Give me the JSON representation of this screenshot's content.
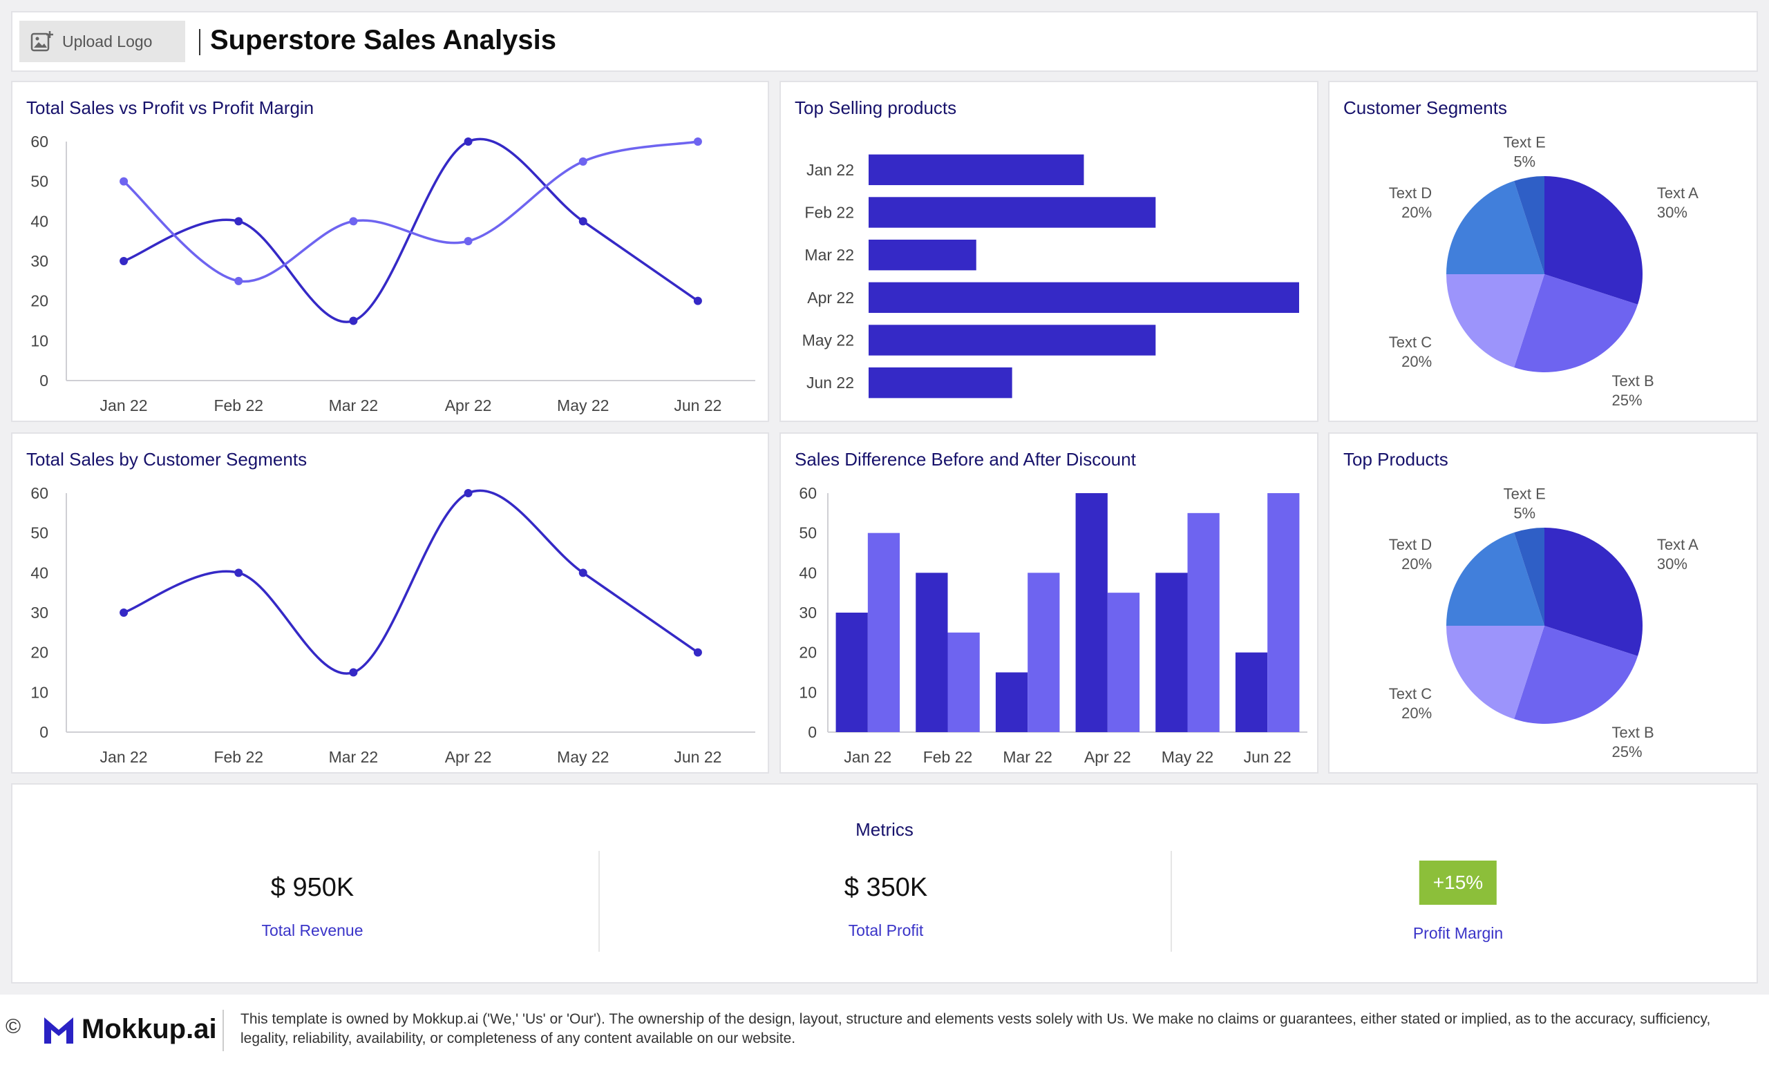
{
  "header": {
    "upload_label": "Upload Logo",
    "title": "Superstore Sales Analysis"
  },
  "colors": {
    "dark": "#3529c6",
    "medium": "#6e64f0",
    "light": "#9c94fb",
    "blue": "#417fdb",
    "darkblue": "#2f5fc6",
    "accent_green": "#8cbf3a",
    "title": "#17126b"
  },
  "cards": {
    "sales_profit": {
      "title": "Total Sales vs Profit vs Profit Margin"
    },
    "top_selling": {
      "title": "Top Selling products"
    },
    "customer_segments": {
      "title": "Customer Segments"
    },
    "sales_segments": {
      "title": "Total Sales by Customer Segments"
    },
    "discount": {
      "title": "Sales Difference Before and After Discount"
    },
    "top_products": {
      "title": "Top Products"
    }
  },
  "chart_data": [
    {
      "id": "sales_profit",
      "type": "line",
      "categories": [
        "Jan 22",
        "Feb 22",
        "Mar 22",
        "Apr 22",
        "May 22",
        "Jun 22"
      ],
      "series": [
        {
          "values": [
            30,
            40,
            15,
            60,
            40,
            20
          ],
          "color": "#3529c6"
        },
        {
          "values": [
            50,
            25,
            40,
            35,
            55,
            60
          ],
          "color": "#6e64f0"
        }
      ],
      "yticks": [
        0,
        10,
        20,
        30,
        40,
        50,
        60
      ],
      "ylim": [
        0,
        60
      ],
      "grid": false
    },
    {
      "id": "top_selling",
      "type": "bar",
      "orientation": "horizontal",
      "categories": [
        "Jan 22",
        "Feb 22",
        "Mar 22",
        "Apr 22",
        "May 22",
        "Jun 22"
      ],
      "values": [
        30,
        40,
        15,
        60,
        40,
        20
      ],
      "xlim": [
        0,
        60
      ],
      "color": "#3529c6"
    },
    {
      "id": "customer_segments",
      "type": "pie",
      "slices": [
        {
          "label": "Text A",
          "pct_label": "30%",
          "value": 30,
          "color": "#3529c6"
        },
        {
          "label": "Text B",
          "pct_label": "25%",
          "value": 25,
          "color": "#6e64f0"
        },
        {
          "label": "Text C",
          "pct_label": "20%",
          "value": 20,
          "color": "#9c94fb"
        },
        {
          "label": "Text D",
          "pct_label": "20%",
          "value": 20,
          "color": "#417fdb"
        },
        {
          "label": "Text E",
          "pct_label": "5%",
          "value": 5,
          "color": "#2f5fc6"
        }
      ]
    },
    {
      "id": "sales_segments",
      "type": "line",
      "categories": [
        "Jan 22",
        "Feb 22",
        "Mar 22",
        "Apr 22",
        "May 22",
        "Jun 22"
      ],
      "series": [
        {
          "values": [
            30,
            40,
            15,
            60,
            40,
            20
          ],
          "color": "#3529c6"
        }
      ],
      "yticks": [
        0,
        10,
        20,
        30,
        40,
        50,
        60
      ],
      "ylim": [
        0,
        60
      ],
      "grid": false
    },
    {
      "id": "discount",
      "type": "bar",
      "orientation": "vertical",
      "categories": [
        "Jan 22",
        "Feb 22",
        "Mar 22",
        "Apr 22",
        "May 22",
        "Jun 22"
      ],
      "series": [
        {
          "values": [
            30,
            40,
            15,
            60,
            40,
            20
          ],
          "color": "#3529c6"
        },
        {
          "values": [
            50,
            25,
            40,
            35,
            55,
            60
          ],
          "color": "#6e64f0"
        }
      ],
      "yticks": [
        0,
        10,
        20,
        30,
        40,
        50,
        60
      ],
      "ylim": [
        0,
        60
      ]
    },
    {
      "id": "top_products",
      "type": "pie",
      "slices": [
        {
          "label": "Text A",
          "pct_label": "30%",
          "value": 30,
          "color": "#3529c6"
        },
        {
          "label": "Text B",
          "pct_label": "25%",
          "value": 25,
          "color": "#6e64f0"
        },
        {
          "label": "Text C",
          "pct_label": "20%",
          "value": 20,
          "color": "#9c94fb"
        },
        {
          "label": "Text D",
          "pct_label": "20%",
          "value": 20,
          "color": "#417fdb"
        },
        {
          "label": "Text E",
          "pct_label": "5%",
          "value": 5,
          "color": "#2f5fc6"
        }
      ]
    }
  ],
  "metrics": {
    "title": "Metrics",
    "revenue": {
      "value": "$ 950K",
      "label": "Total Revenue"
    },
    "profit": {
      "value": "$ 350K",
      "label": "Total Profit"
    },
    "margin": {
      "value": "+15%",
      "label": "Profit Margin"
    }
  },
  "footer": {
    "copyright": "©",
    "brand": "Mokkup.ai",
    "disclaimer": "This template is owned by Mokkup.ai ('We,' 'Us' or 'Our'). The ownership of the design, layout, structure and elements vests solely with Us. We make no claims or guarantees, either stated or implied, as to the accuracy, sufficiency, legality, reliability, availability, or completeness of any content available on our website."
  },
  "icons": {
    "upload": "image-add-icon",
    "brand": "mokkup-logo-icon"
  }
}
